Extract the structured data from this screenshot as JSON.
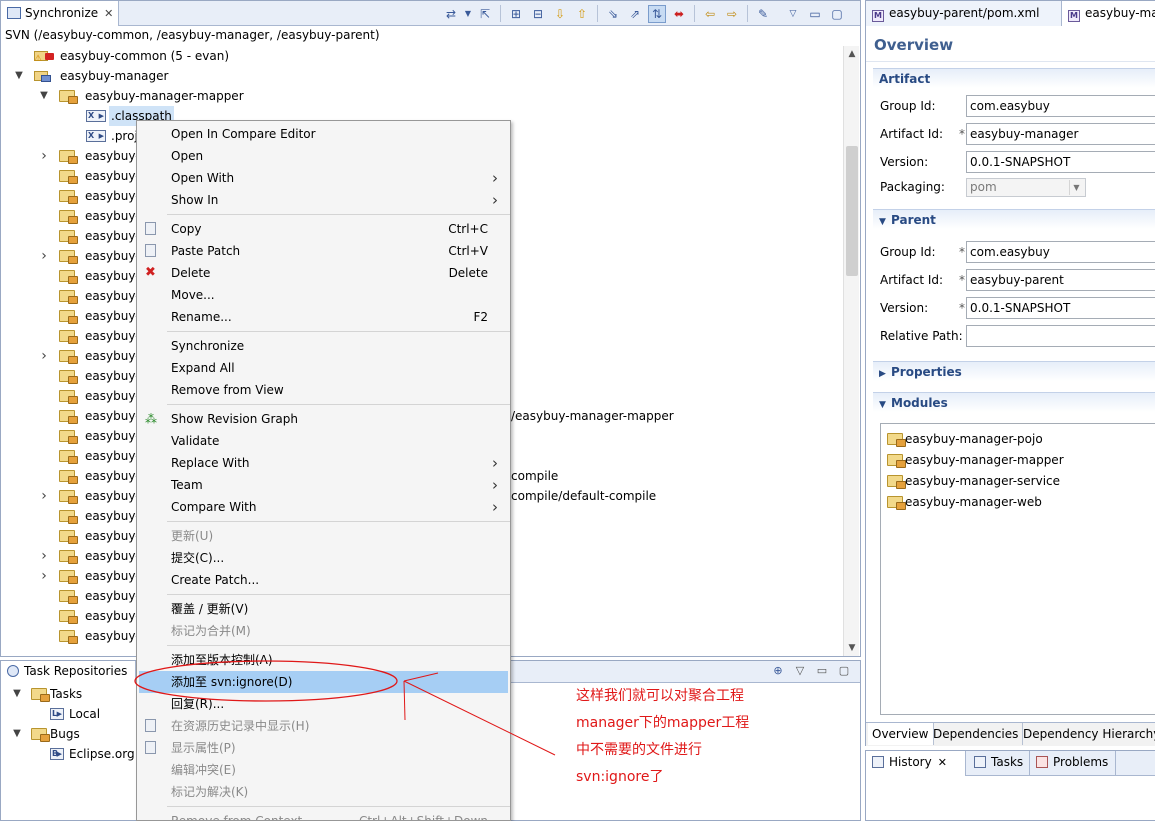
{
  "sync": {
    "tab_title": "Synchronize",
    "tab_close": "✕",
    "subtitle": "SVN (/easybuy-common, /easybuy-manager, /easybuy-parent)",
    "tree": [
      {
        "label": "easybuy-common (5 - evan)",
        "type": "project-out"
      },
      {
        "label": "easybuy-manager",
        "type": "project"
      },
      {
        "label": "easybuy-manager-mapper",
        "type": "folder"
      },
      {
        "label": ".classpath",
        "type": "file"
      },
      {
        "label": ".proj",
        "type": "file"
      },
      {
        "label": "easybuy-"
      },
      {
        "label": "easybuy-"
      },
      {
        "label": "easybuy-"
      },
      {
        "label": "easybuy-"
      },
      {
        "label": "easybuy-"
      },
      {
        "label": "easybuy-"
      },
      {
        "label": "easybuy-"
      },
      {
        "label": "easybuy-"
      },
      {
        "label": "easybuy-"
      },
      {
        "label": "easybuy-"
      },
      {
        "label": "easybuy-"
      },
      {
        "label": "easybuy-"
      },
      {
        "label": "easybuy-"
      },
      {
        "label": "easybuy-"
      },
      {
        "label": "easybuy-"
      },
      {
        "label": "easybuy-"
      },
      {
        "label": "easybuy-"
      },
      {
        "label": "easybuy-"
      },
      {
        "label": "easybuy-"
      },
      {
        "label": "easybuy-"
      },
      {
        "label": "easybuy-"
      },
      {
        "label": "easybuy-"
      },
      {
        "label": "easybuy-"
      },
      {
        "label": "easybuy-"
      },
      {
        "label": "easybuy-"
      }
    ],
    "tree_extra": {
      "row18": "/easybuy-manager-mapper",
      "row21": "compile",
      "row22": "compile/default-compile"
    }
  },
  "task": {
    "tab_title": "Task Repositories",
    "items": [
      {
        "label": "Tasks"
      },
      {
        "label": "Local"
      },
      {
        "label": "Bugs"
      },
      {
        "label": "Eclipse.org"
      }
    ]
  },
  "menu": {
    "items": [
      {
        "label": "Open In Compare Editor"
      },
      {
        "label": "Open"
      },
      {
        "label": "Open With"
      },
      {
        "label": "Show In"
      },
      {
        "label": "Copy",
        "shortcut": "Ctrl+C"
      },
      {
        "label": "Paste Patch",
        "shortcut": "Ctrl+V"
      },
      {
        "label": "Delete",
        "shortcut": "Delete"
      },
      {
        "label": "Move..."
      },
      {
        "label": "Rename...",
        "shortcut": "F2"
      },
      {
        "label": "Synchronize"
      },
      {
        "label": "Expand All"
      },
      {
        "label": "Remove from View"
      },
      {
        "label": "Show Revision Graph"
      },
      {
        "label": "Validate"
      },
      {
        "label": "Replace With"
      },
      {
        "label": "Team"
      },
      {
        "label": "Compare With"
      },
      {
        "label": "更新(U)"
      },
      {
        "label": "提交(C)..."
      },
      {
        "label": "Create Patch..."
      },
      {
        "label": "覆盖 / 更新(V)"
      },
      {
        "label": "标记为合并(M)"
      },
      {
        "label": "添加至版本控制(A)"
      },
      {
        "label": "添加至 svn:ignore(D)"
      },
      {
        "label": "回复(R)..."
      },
      {
        "label": "在资源历史记录中显示(H)"
      },
      {
        "label": "显示属性(P)"
      },
      {
        "label": "编辑冲突(E)"
      },
      {
        "label": "标记为解决(K)"
      },
      {
        "label": "Remove from Context",
        "shortcut": "Ctrl+Alt+Shift+Down"
      }
    ]
  },
  "annotation": {
    "lines": [
      "这样我们就可以对聚合工程",
      "manager下的mapper工程",
      "中不需要的文件进行",
      "svn:ignore了"
    ],
    "color": "#e01818"
  },
  "editor": {
    "tabs": [
      "easybuy-parent/pom.xml",
      "easybuy-ma"
    ],
    "overview_title": "Overview",
    "artifact": {
      "header": "Artifact",
      "group_id_label": "Group Id:",
      "group_id": "com.easybuy",
      "artifact_id_label": "Artifact Id:",
      "artifact_id": "easybuy-manager",
      "version_label": "Version:",
      "version": "0.0.1-SNAPSHOT",
      "packaging_label": "Packaging:",
      "packaging": "pom"
    },
    "parent": {
      "header": "Parent",
      "group_id_label": "Group Id:",
      "group_id": "com.easybuy",
      "artifact_id_label": "Artifact Id:",
      "artifact_id": "easybuy-parent",
      "version_label": "Version:",
      "version": "0.0.1-SNAPSHOT",
      "relative_path_label": "Relative Path:",
      "relative_path": ""
    },
    "properties_header": "Properties",
    "modules_header": "Modules",
    "modules": [
      "easybuy-manager-pojo",
      "easybuy-manager-mapper",
      "easybuy-manager-service",
      "easybuy-manager-web"
    ],
    "bottom_tabs": [
      "Overview",
      "Dependencies",
      "Dependency Hierarchy"
    ]
  },
  "history": {
    "tabs": [
      "History",
      "Tasks",
      "Problems"
    ]
  }
}
